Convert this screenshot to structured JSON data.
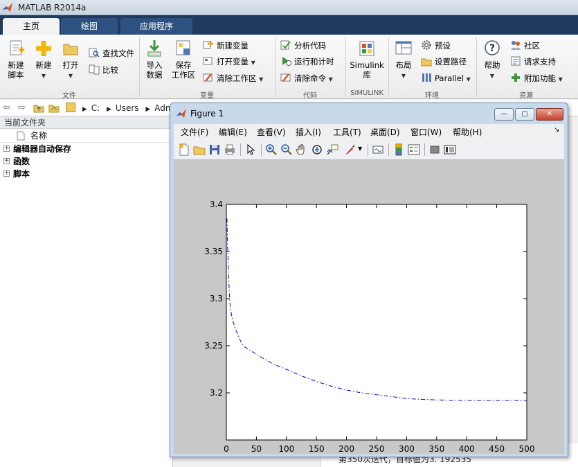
{
  "app": {
    "title": "MATLAB R2014a"
  },
  "tabs": [
    {
      "label": "主页"
    },
    {
      "label": "绘图"
    },
    {
      "label": "应用程序"
    }
  ],
  "ribbon": {
    "file": {
      "group_label": "文件",
      "new_script": [
        "新建",
        "脚本"
      ],
      "new": "新建",
      "open": "打开",
      "find_files": "查找文件",
      "compare": "比较"
    },
    "variable": {
      "group_label": "变量",
      "import": [
        "导入",
        "数据"
      ],
      "save": [
        "保存",
        "工作区"
      ],
      "new_var": "新建变量",
      "open_var": "打开变量",
      "clear_ws": "清除工作区"
    },
    "code": {
      "group_label": "代码",
      "analyze": "分析代码",
      "run_time": "运行和计时",
      "clear_cmd": "清除命令"
    },
    "simulink": {
      "group_label": "SIMULINK",
      "lib": [
        "Simulink",
        "库"
      ]
    },
    "env": {
      "group_label": "环境",
      "layout": "布局",
      "prefs": "预设",
      "set_path": "设置路径",
      "parallel": "Parallel"
    },
    "resources": {
      "group_label": "资源",
      "help": "帮助",
      "community": "社区",
      "support": "请求支持",
      "addons": "附加功能"
    }
  },
  "address": {
    "path": [
      "C:",
      "Users",
      "Adm"
    ]
  },
  "current_folder": {
    "header": "当前文件夹",
    "column_name": "名称",
    "items": [
      {
        "label": "编辑器自动保存"
      },
      {
        "label": "函数"
      },
      {
        "label": "脚本"
      }
    ]
  },
  "command_window": {
    "line": "第350次迭代，目标值为3. 192535"
  },
  "figure": {
    "title": "Figure 1",
    "menu": [
      "文件(F)",
      "编辑(E)",
      "查看(V)",
      "插入(I)",
      "工具(T)",
      "桌面(D)",
      "窗口(W)",
      "帮助(H)"
    ],
    "toolbar_icons": [
      "new-figure-icon",
      "open-file-icon",
      "save-icon",
      "print-icon",
      "edit-plot-icon",
      "zoom-in-icon",
      "zoom-out-icon",
      "pan-icon",
      "rotate-3d-icon",
      "data-cursor-icon",
      "brush-icon",
      "link-plot-icon",
      "colorbar-icon",
      "legend-icon",
      "hide-plot-tools-icon",
      "show-plot-tools-icon"
    ]
  },
  "chart_data": {
    "type": "line",
    "title": "",
    "xlabel": "",
    "ylabel": "",
    "xlim": [
      0,
      500
    ],
    "ylim": [
      3.15,
      3.4
    ],
    "xticks": [
      "0",
      "50",
      "100",
      "150",
      "200",
      "250",
      "300",
      "350",
      "400",
      "450",
      "500"
    ],
    "yticks": [
      "3.2",
      "3.25",
      "3.3",
      "3.35",
      "3.4"
    ],
    "line_style": "dash-dot",
    "line_color": "#0000cc",
    "series": [
      {
        "x": [
          1,
          2,
          3,
          4,
          5,
          6,
          8,
          10,
          15,
          20,
          25,
          30,
          40,
          50,
          60,
          80,
          100,
          125,
          150,
          175,
          200,
          225,
          250,
          275,
          300,
          325,
          350,
          375,
          400,
          425,
          450,
          475,
          500
        ],
        "y": [
          3.385,
          3.36,
          3.34,
          3.32,
          3.305,
          3.295,
          3.285,
          3.278,
          3.268,
          3.26,
          3.253,
          3.249,
          3.245,
          3.241,
          3.237,
          3.23,
          3.225,
          3.218,
          3.212,
          3.207,
          3.203,
          3.2,
          3.198,
          3.196,
          3.194,
          3.193,
          3.1925,
          3.1923,
          3.1921,
          3.192,
          3.192,
          3.192,
          3.192
        ]
      }
    ]
  },
  "colors": {
    "tabbar": "#1f3a5c",
    "figure_frame": "#c8d9ec",
    "plot_line": "#0000cc"
  }
}
